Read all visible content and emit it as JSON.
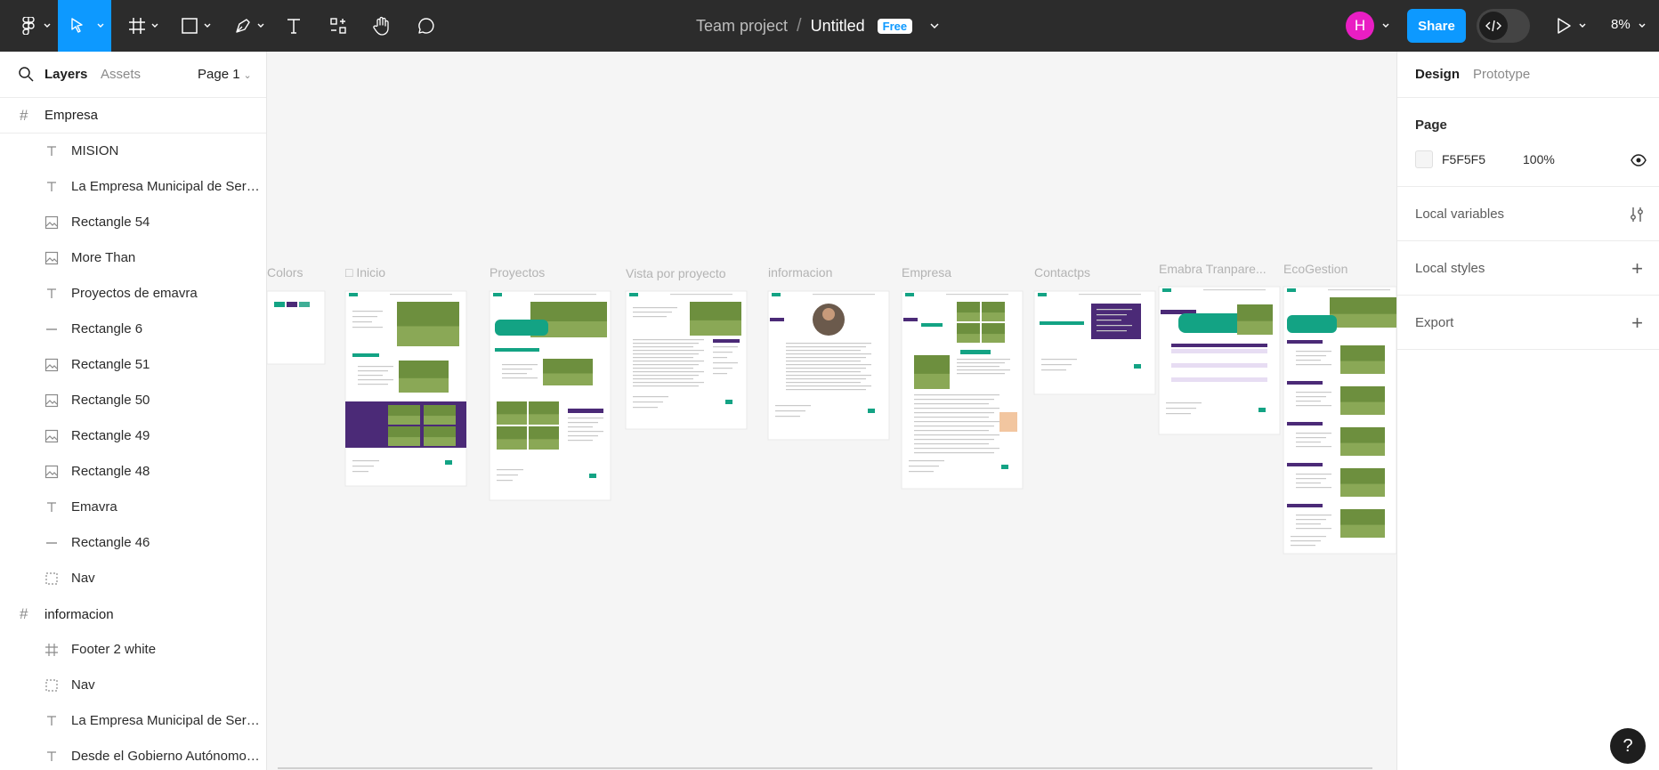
{
  "toolbar": {
    "team": "Team project",
    "separator": "/",
    "file_name": "Untitled",
    "plan_badge": "Free",
    "avatar_initial": "H",
    "share_label": "Share",
    "zoom": "8%",
    "colors": {
      "bar": "#2c2c2c",
      "accent": "#0d99ff",
      "avatar": "#e91ec3"
    }
  },
  "left_panel": {
    "tab_layers": "Layers",
    "tab_assets": "Assets",
    "page_selector": "Page 1",
    "frames": [
      {
        "name": "Empresa",
        "layers": [
          {
            "icon": "text-icon",
            "name": "MISION"
          },
          {
            "icon": "text-icon",
            "name": "La Empresa Municipal de Servicios..."
          },
          {
            "icon": "image-icon",
            "name": "Rectangle 54"
          },
          {
            "icon": "image-icon",
            "name": "More Than"
          },
          {
            "icon": "text-icon",
            "name": "Proyectos de emavra"
          },
          {
            "icon": "line-icon",
            "name": "Rectangle 6"
          },
          {
            "icon": "image-icon",
            "name": "Rectangle 51"
          },
          {
            "icon": "image-icon",
            "name": "Rectangle 50"
          },
          {
            "icon": "image-icon",
            "name": "Rectangle 49"
          },
          {
            "icon": "image-icon",
            "name": "Rectangle 48"
          },
          {
            "icon": "text-icon",
            "name": "Emavra"
          },
          {
            "icon": "line-icon",
            "name": "Rectangle 46"
          },
          {
            "icon": "group-icon",
            "name": "Nav"
          }
        ]
      },
      {
        "name": "informacion",
        "layers": [
          {
            "icon": "frame-icon",
            "name": "Footer 2 white"
          },
          {
            "icon": "group-icon",
            "name": "Nav"
          },
          {
            "icon": "text-icon",
            "name": "La Empresa Municipal de Servicios..."
          },
          {
            "icon": "text-icon",
            "name": "Desde el Gobierno Autónomo ..."
          }
        ]
      }
    ]
  },
  "canvas": {
    "frames": [
      {
        "name": "Colors"
      },
      {
        "name": "Inicio"
      },
      {
        "name": "Proyectos"
      },
      {
        "name": "Vista por proyecto"
      },
      {
        "name": "informacion"
      },
      {
        "name": "Empresa"
      },
      {
        "name": "Contactps"
      },
      {
        "name": "Emabra Tranpare..."
      },
      {
        "name": "EcoGestion"
      }
    ],
    "brand_colors": {
      "teal": "#13a384",
      "purple": "#4b2a77",
      "green": "#6d8f3e"
    }
  },
  "right_panel": {
    "tab_design": "Design",
    "tab_prototype": "Prototype",
    "page_title": "Page",
    "page_color": "F5F5F5",
    "page_opacity": "100%",
    "local_variables": "Local variables",
    "local_styles": "Local styles",
    "export": "Export"
  },
  "help_label": "?"
}
